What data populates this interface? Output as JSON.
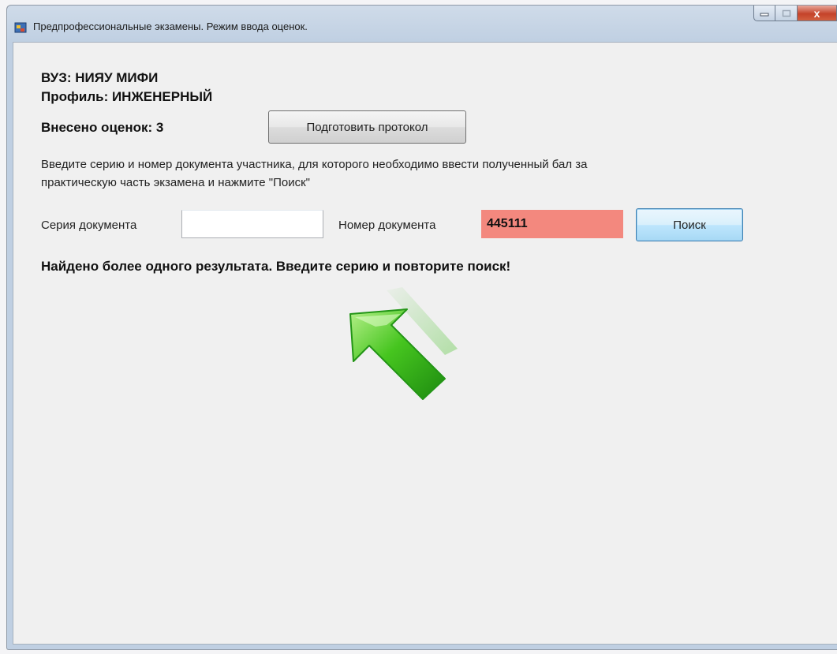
{
  "window": {
    "title": "Предпрофессиональные экзамены. Режим ввода оценок.",
    "close_glyph": "x"
  },
  "info": {
    "university": "ВУЗ: НИЯУ МИФИ",
    "profile": "Профиль: ИНЖЕНЕРНЫЙ",
    "grades_entered": "Внесено оценок: 3"
  },
  "toolbar": {
    "prepare_protocol_label": "Подготовить протокол"
  },
  "instructions": {
    "line1": "Введите серию и номер документа участника, для которого необходимо ввести полученный бал за",
    "line2": "практическую часть экзамена и нажмите \"Поиск\""
  },
  "search": {
    "series_label": "Серия документа",
    "series_value": "",
    "number_label": "Номер документа",
    "number_value": "445111",
    "search_button_label": "Поиск"
  },
  "status": {
    "message": "Найдено более одного результата. Введите серию и повторите поиск!"
  },
  "colors": {
    "error_field": "#f3887e",
    "arrow_green": "#3fbf1f"
  },
  "icons": {
    "app": "app-window-icon",
    "pointer": "green-arrow-icon"
  }
}
